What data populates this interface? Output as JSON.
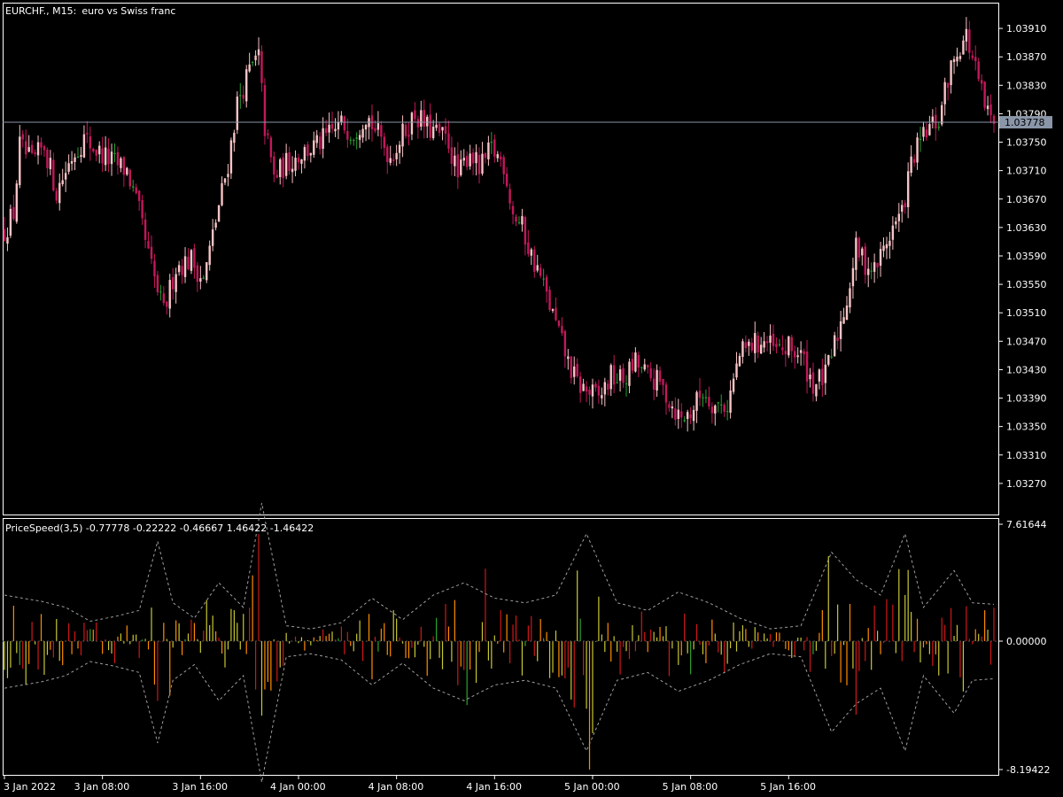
{
  "header": {
    "symbol": "EURCHF.",
    "timeframe": "M15:",
    "description": "euro vs Swiss franc"
  },
  "indicator": {
    "label": "PriceSpeed(3,5) -0.77778 -0.22222 -0.46667 1.46422 -1.46422",
    "name": "PriceSpeed(3,5)",
    "values": [
      -0.77778,
      -0.22222,
      -0.46667,
      1.46422,
      -1.46422
    ]
  },
  "price_axis": {
    "ticks": [
      "1.03910",
      "1.03870",
      "1.03830",
      "1.03790",
      "1.03750",
      "1.03710",
      "1.03670",
      "1.03630",
      "1.03590",
      "1.03550",
      "1.03510",
      "1.03470",
      "1.03430",
      "1.03390",
      "1.03350",
      "1.03310",
      "1.03270"
    ],
    "current_price": "1.03778"
  },
  "indicator_axis": {
    "max": "7.61644",
    "zero": "0.00000",
    "min": "-8.19422"
  },
  "time_axis": {
    "ticks": [
      "3 Jan 2022",
      "3 Jan 08:00",
      "3 Jan 16:00",
      "4 Jan 00:00",
      "4 Jan 08:00",
      "4 Jan 16:00",
      "5 Jan 00:00",
      "5 Jan 08:00",
      "5 Jan 16:00"
    ]
  },
  "colors": {
    "background": "#000000",
    "bull_candle": "#f7c3c6",
    "bear_candle": "#c2185b",
    "doji_candle": "#27a030",
    "price_line": "#8a96a8",
    "price_label_bg": "#8a96a8",
    "hist_up": "#ff8c00",
    "hist_down": "#d01818",
    "hist_mid": "#c8c832",
    "hist_green": "#2ea02e",
    "band": "#a0a0a0",
    "axis": "#ffffff"
  },
  "chart_data": [
    {
      "type": "candlestick",
      "title": "EURCHF., M15:  euro vs Swiss franc",
      "ylim": [
        1.0323,
        1.0394
      ],
      "price_level": 1.03778,
      "x_ticks": [
        "3 Jan 2022",
        "3 Jan 08:00",
        "3 Jan 16:00",
        "4 Jan 00:00",
        "4 Jan 08:00",
        "4 Jan 16:00",
        "5 Jan 00:00",
        "5 Jan 08:00",
        "5 Jan 16:00"
      ],
      "close_path": [
        [
          0,
          1.03625
        ],
        [
          3,
          1.0365
        ],
        [
          5,
          1.03745
        ],
        [
          9,
          1.0372
        ],
        [
          13,
          1.03745
        ],
        [
          17,
          1.0368
        ],
        [
          22,
          1.0373
        ],
        [
          26,
          1.03755
        ],
        [
          31,
          1.03735
        ],
        [
          36,
          1.0372
        ],
        [
          40,
          1.0371
        ],
        [
          44,
          1.0365
        ],
        [
          47,
          1.0359
        ],
        [
          50,
          1.0354
        ],
        [
          52,
          1.0351
        ],
        [
          56,
          1.03575
        ],
        [
          61,
          1.03585
        ],
        [
          65,
          1.03555
        ],
        [
          69,
          1.0364
        ],
        [
          73,
          1.0372
        ],
        [
          76,
          1.03805
        ],
        [
          80,
          1.0385
        ],
        [
          83,
          1.0387
        ],
        [
          85,
          1.0377
        ],
        [
          88,
          1.037
        ],
        [
          92,
          1.0372
        ],
        [
          97,
          1.03735
        ],
        [
          102,
          1.03745
        ],
        [
          106,
          1.0376
        ],
        [
          110,
          1.03775
        ],
        [
          114,
          1.03765
        ],
        [
          118,
          1.0379
        ],
        [
          122,
          1.0376
        ],
        [
          126,
          1.0373
        ],
        [
          130,
          1.0376
        ],
        [
          134,
          1.0379
        ],
        [
          138,
          1.0377
        ],
        [
          142,
          1.0376
        ],
        [
          145,
          1.0375
        ],
        [
          148,
          1.037
        ],
        [
          152,
          1.0374
        ],
        [
          155,
          1.0371
        ],
        [
          159,
          1.0374
        ],
        [
          163,
          1.0372
        ],
        [
          166,
          1.0365
        ],
        [
          169,
          1.0363
        ],
        [
          172,
          1.0359
        ],
        [
          175,
          1.0356
        ],
        [
          178,
          1.0352
        ],
        [
          181,
          1.0348
        ],
        [
          184,
          1.0344
        ],
        [
          187,
          1.0341
        ],
        [
          190,
          1.034
        ],
        [
          194,
          1.0339
        ],
        [
          198,
          1.0342
        ],
        [
          202,
          1.03415
        ],
        [
          206,
          1.0344
        ],
        [
          210,
          1.0342
        ],
        [
          214,
          1.0341
        ],
        [
          218,
          1.0338
        ],
        [
          221,
          1.0336
        ],
        [
          224,
          1.0337
        ],
        [
          228,
          1.034
        ],
        [
          232,
          1.0338
        ],
        [
          236,
          1.0338
        ],
        [
          240,
          1.0345
        ],
        [
          244,
          1.03465
        ],
        [
          248,
          1.0347
        ],
        [
          252,
          1.03455
        ],
        [
          256,
          1.0346
        ],
        [
          260,
          1.0345
        ],
        [
          264,
          1.0341
        ],
        [
          268,
          1.0342
        ],
        [
          272,
          1.0348
        ],
        [
          275,
          1.0353
        ],
        [
          278,
          1.036
        ],
        [
          281,
          1.0358
        ],
        [
          284,
          1.0357
        ],
        [
          287,
          1.036
        ],
        [
          290,
          1.0363
        ],
        [
          293,
          1.0365
        ],
        [
          296,
          1.0372
        ],
        [
          299,
          1.0375
        ],
        [
          302,
          1.0377
        ],
        [
          305,
          1.0378
        ],
        [
          308,
          1.0384
        ],
        [
          311,
          1.0388
        ],
        [
          314,
          1.039
        ],
        [
          317,
          1.0385
        ],
        [
          320,
          1.038
        ],
        [
          323,
          1.0377
        ]
      ]
    },
    {
      "type": "bar",
      "title": "PriceSpeed(3,5) -0.77778 -0.22222 -0.46667 1.46422 -1.46422",
      "ylim": [
        -8.19422,
        7.61644
      ],
      "last_values": [
        -0.77778,
        -0.22222,
        -0.46667,
        1.46422,
        -1.46422
      ],
      "band_upper_path": [
        [
          0,
          3.0
        ],
        [
          12,
          2.6
        ],
        [
          20,
          2.2
        ],
        [
          28,
          1.3
        ],
        [
          36,
          1.6
        ],
        [
          44,
          2.0
        ],
        [
          50,
          6.5
        ],
        [
          55,
          2.5
        ],
        [
          62,
          1.5
        ],
        [
          70,
          3.8
        ],
        [
          78,
          2.2
        ],
        [
          84,
          9.0
        ],
        [
          92,
          1.0
        ],
        [
          100,
          0.8
        ],
        [
          110,
          1.2
        ],
        [
          120,
          2.8
        ],
        [
          130,
          1.4
        ],
        [
          140,
          3.0
        ],
        [
          150,
          3.8
        ],
        [
          160,
          2.8
        ],
        [
          170,
          2.5
        ],
        [
          180,
          3.0
        ],
        [
          190,
          7.0
        ],
        [
          200,
          2.5
        ],
        [
          210,
          2.0
        ],
        [
          220,
          3.2
        ],
        [
          230,
          2.5
        ],
        [
          240,
          1.5
        ],
        [
          250,
          0.8
        ],
        [
          260,
          1.0
        ],
        [
          270,
          5.8
        ],
        [
          278,
          4.0
        ],
        [
          286,
          3.0
        ],
        [
          294,
          7.0
        ],
        [
          300,
          2.2
        ],
        [
          310,
          4.6
        ],
        [
          316,
          2.5
        ],
        [
          323,
          2.4
        ]
      ],
      "band_lower_path": [
        [
          0,
          -3.0
        ],
        [
          12,
          -2.6
        ],
        [
          20,
          -2.2
        ],
        [
          28,
          -1.3
        ],
        [
          36,
          -1.6
        ],
        [
          44,
          -2.0
        ],
        [
          50,
          -6.5
        ],
        [
          55,
          -2.5
        ],
        [
          62,
          -1.5
        ],
        [
          70,
          -3.8
        ],
        [
          78,
          -2.2
        ],
        [
          84,
          -9.0
        ],
        [
          92,
          -1.0
        ],
        [
          100,
          -0.8
        ],
        [
          110,
          -1.2
        ],
        [
          120,
          -2.8
        ],
        [
          130,
          -1.4
        ],
        [
          140,
          -3.0
        ],
        [
          150,
          -3.8
        ],
        [
          160,
          -2.8
        ],
        [
          170,
          -2.5
        ],
        [
          180,
          -3.0
        ],
        [
          190,
          -7.0
        ],
        [
          200,
          -2.5
        ],
        [
          210,
          -2.0
        ],
        [
          220,
          -3.2
        ],
        [
          230,
          -2.5
        ],
        [
          240,
          -1.5
        ],
        [
          250,
          -0.8
        ],
        [
          260,
          -1.0
        ],
        [
          270,
          -5.8
        ],
        [
          278,
          -4.0
        ],
        [
          286,
          -3.0
        ],
        [
          294,
          -7.0
        ],
        [
          300,
          -2.2
        ],
        [
          310,
          -4.6
        ],
        [
          316,
          -2.5
        ],
        [
          323,
          -2.4
        ]
      ],
      "bar_count": 324
    }
  ]
}
